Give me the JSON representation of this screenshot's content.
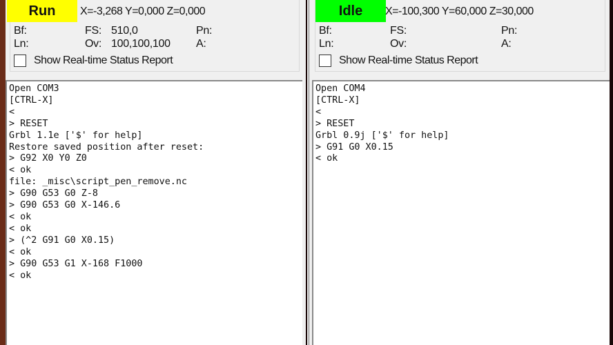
{
  "left": {
    "state": "Run",
    "state_color": "#ffff00",
    "position": "X=-3,268 Y=0,000 Z=0,000",
    "bf": "Bf:",
    "fs": "FS:",
    "fs_value": "510,0",
    "pn": "Pn:",
    "ln": "Ln:",
    "ov": "Ov:",
    "ov_value": "100,100,100",
    "a": "A:",
    "checkbox_label": "Show Real-time Status Report",
    "console": [
      "Open COM3",
      "[CTRL-X]",
      "<",
      "> RESET",
      "Grbl 1.1e ['$' for help]",
      "Restore saved position after reset:",
      "> G92 X0 Y0 Z0",
      "< ok",
      "file: _misc\\script_pen_remove.nc",
      "> G90 G53 G0 Z-8",
      "> G90 G53 G0 X-146.6",
      "< ok",
      "< ok",
      "> (^2 G91 G0 X0.15)",
      "< ok",
      "> G90 G53 G1 X-168 F1000",
      "< ok"
    ]
  },
  "right": {
    "state": "Idle",
    "state_color": "#00ff00",
    "position": "X=-100,300 Y=60,000 Z=30,000",
    "bf": "Bf:",
    "fs": "FS:",
    "pn": "Pn:",
    "ln": "Ln:",
    "ov": "Ov:",
    "a": "A:",
    "checkbox_label": "Show Real-time Status Report",
    "console": [
      "Open COM4",
      "[CTRL-X]",
      "<",
      "> RESET",
      "Grbl 0.9j ['$' for help]",
      "> G91 G0 X0.15",
      "< ok"
    ]
  }
}
